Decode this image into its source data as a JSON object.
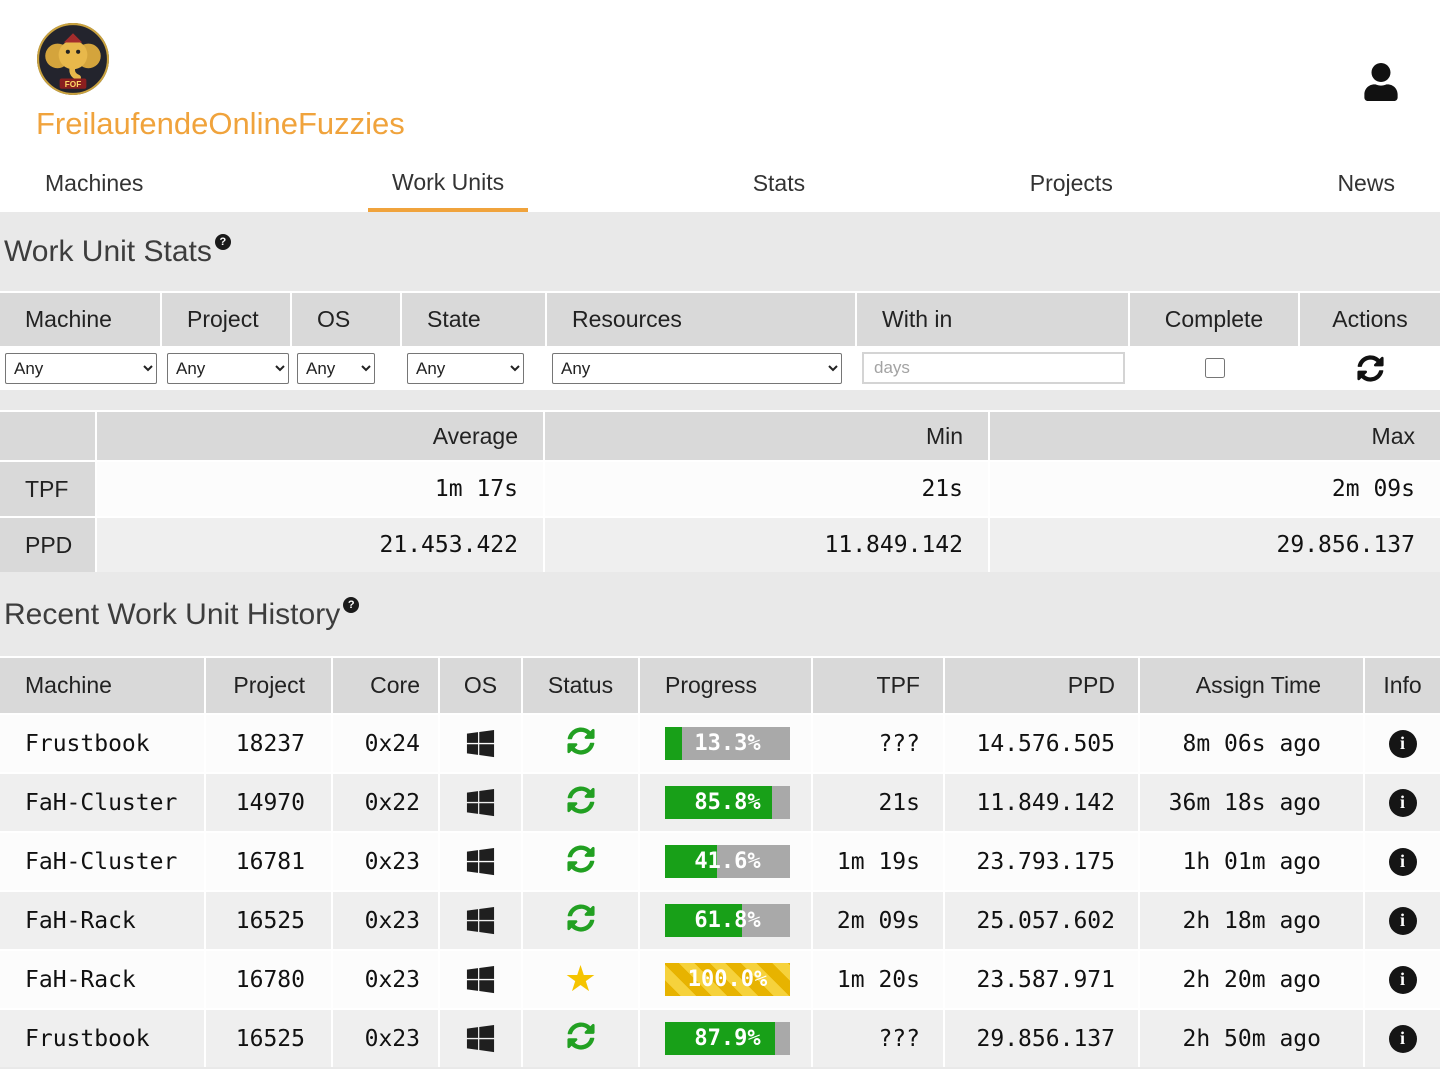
{
  "site": {
    "title": "FreilaufendeOnlineFuzzies",
    "logo_banner": "FOF"
  },
  "icons": {
    "help": "?",
    "info": "i",
    "star": "★"
  },
  "colors": {
    "accent_orange": "#F0A33C",
    "section_gray": "#E9E9E9",
    "header_gray": "#D9D9D9",
    "progress_green": "#18A018",
    "status_green": "#22A022",
    "star_yellow": "#F5C400"
  },
  "nav": {
    "tabs": [
      {
        "label": "Machines",
        "active": false
      },
      {
        "label": "Work Units",
        "active": true
      },
      {
        "label": "Stats",
        "active": false
      },
      {
        "label": "Projects",
        "active": false
      },
      {
        "label": "News",
        "active": false
      }
    ]
  },
  "wu_stats": {
    "heading": "Work Unit Stats",
    "filters": {
      "headers": [
        "Machine",
        "Project",
        "OS",
        "State",
        "Resources",
        "With in",
        "Complete",
        "Actions"
      ],
      "values": {
        "machine": "Any",
        "project": "Any",
        "os": "Any",
        "state": "Any",
        "resources": "Any"
      },
      "within_placeholder": "days",
      "complete_checked": false
    },
    "summary": {
      "col_headers": [
        "Average",
        "Min",
        "Max"
      ],
      "rows": [
        {
          "label": "TPF",
          "average": "1m 17s",
          "min": "21s",
          "max": "2m 09s"
        },
        {
          "label": "PPD",
          "average": "21.453.422",
          "min": "11.849.142",
          "max": "29.856.137"
        }
      ]
    }
  },
  "history": {
    "heading": "Recent Work Unit History",
    "columns": [
      "Machine",
      "Project",
      "Core",
      "OS",
      "Status",
      "Progress",
      "TPF",
      "PPD",
      "Assign Time",
      "Info"
    ],
    "rows": [
      {
        "machine": "Frustbook",
        "project": "18237",
        "core": "0x24",
        "os": "windows",
        "status": "running",
        "progress": 13.3,
        "progress_label": "13.3%",
        "tpf": "???",
        "ppd": "14.576.505",
        "assign": "8m 06s ago"
      },
      {
        "machine": "FaH-Cluster",
        "project": "14970",
        "core": "0x22",
        "os": "windows",
        "status": "running",
        "progress": 85.8,
        "progress_label": "85.8%",
        "tpf": "21s",
        "ppd": "11.849.142",
        "assign": "36m 18s ago"
      },
      {
        "machine": "FaH-Cluster",
        "project": "16781",
        "core": "0x23",
        "os": "windows",
        "status": "running",
        "progress": 41.6,
        "progress_label": "41.6%",
        "tpf": "1m 19s",
        "ppd": "23.793.175",
        "assign": "1h 01m ago"
      },
      {
        "machine": "FaH-Rack",
        "project": "16525",
        "core": "0x23",
        "os": "windows",
        "status": "running",
        "progress": 61.8,
        "progress_label": "61.8%",
        "tpf": "2m 09s",
        "ppd": "25.057.602",
        "assign": "2h 18m ago"
      },
      {
        "machine": "FaH-Rack",
        "project": "16780",
        "core": "0x23",
        "os": "windows",
        "status": "finished",
        "progress": 100.0,
        "progress_label": "100.0%",
        "tpf": "1m 20s",
        "ppd": "23.587.971",
        "assign": "2h 20m ago"
      },
      {
        "machine": "Frustbook",
        "project": "16525",
        "core": "0x23",
        "os": "windows",
        "status": "running",
        "progress": 87.9,
        "progress_label": "87.9%",
        "tpf": "???",
        "ppd": "29.856.137",
        "assign": "2h 50m ago"
      }
    ]
  }
}
